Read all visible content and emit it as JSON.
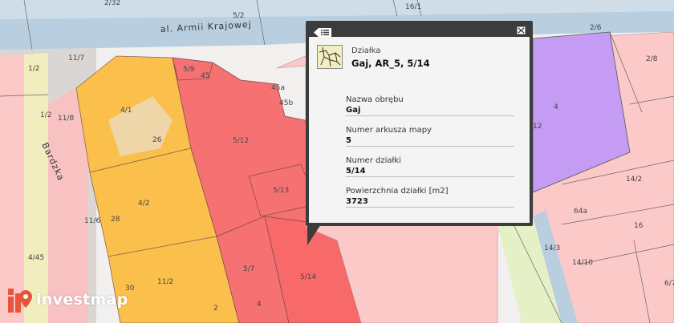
{
  "map": {
    "road_label": "al. Armii Krajowej",
    "street_label": "Bardzka",
    "parcel_labels": [
      "2/32",
      "16/1",
      "5/2",
      "2/6",
      "2/8",
      "11/7",
      "1/2",
      "5/9",
      "45",
      "45a",
      "45b",
      "4/1",
      "26",
      "5/12",
      "1/2",
      "11/8",
      "4",
      "12",
      "4/2",
      "28",
      "5/13",
      "14/2",
      "11/6",
      "64a",
      "14/3",
      "14/10",
      "4/45",
      "5/7",
      "5/14",
      "30",
      "11/2",
      "2",
      "4",
      "16",
      "6/7"
    ]
  },
  "popup": {
    "feature_type": "Działka",
    "feature_title": "Gaj, AR_5, 5/14",
    "attributes": [
      {
        "key": "Nazwa obrębu",
        "value": "Gaj"
      },
      {
        "key": "Numer arkusza mapy",
        "value": "5"
      },
      {
        "key": "Numer działki",
        "value": "5/14"
      },
      {
        "key": "Powierzchnia działki [m2]",
        "value": "3723"
      }
    ],
    "icons": {
      "menu": "list-menu-icon",
      "close": "close-icon",
      "layer": "parcel-layer-icon"
    }
  },
  "logo": {
    "text": "investmap"
  },
  "colors": {
    "selected_parcel": "#f86a6a",
    "orange_parcel": "#fbbf4b",
    "pink_parcel": "#fcc9c9",
    "purple_parcel": "#c59cf4",
    "road": "#b9cede"
  }
}
